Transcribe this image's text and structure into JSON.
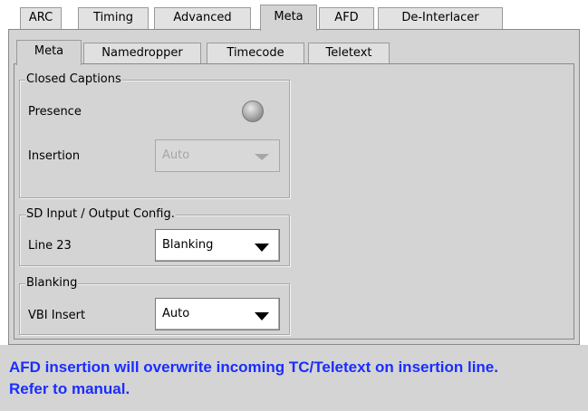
{
  "top_tabs": [
    "ARC",
    "Timing",
    "Advanced",
    "Meta",
    "AFD",
    "De-Interlacer"
  ],
  "sub_tabs": [
    "Meta",
    "Namedropper",
    "Timecode",
    "Teletext"
  ],
  "closed_captions": {
    "title": "Closed Captions",
    "presence_label": "Presence",
    "insertion_label": "Insertion",
    "insertion_value": "Auto"
  },
  "sd_config": {
    "title": "SD Input / Output Config.",
    "line23_label": "Line 23",
    "line23_value": "Blanking"
  },
  "blanking": {
    "title": "Blanking",
    "vbi_label": "VBI Insert",
    "vbi_value": "Auto"
  },
  "message": {
    "line1": "AFD insertion will overwrite incoming TC/Teletext on insertion line.",
    "line2": "Refer to manual.",
    "color": "#1a2dff"
  }
}
